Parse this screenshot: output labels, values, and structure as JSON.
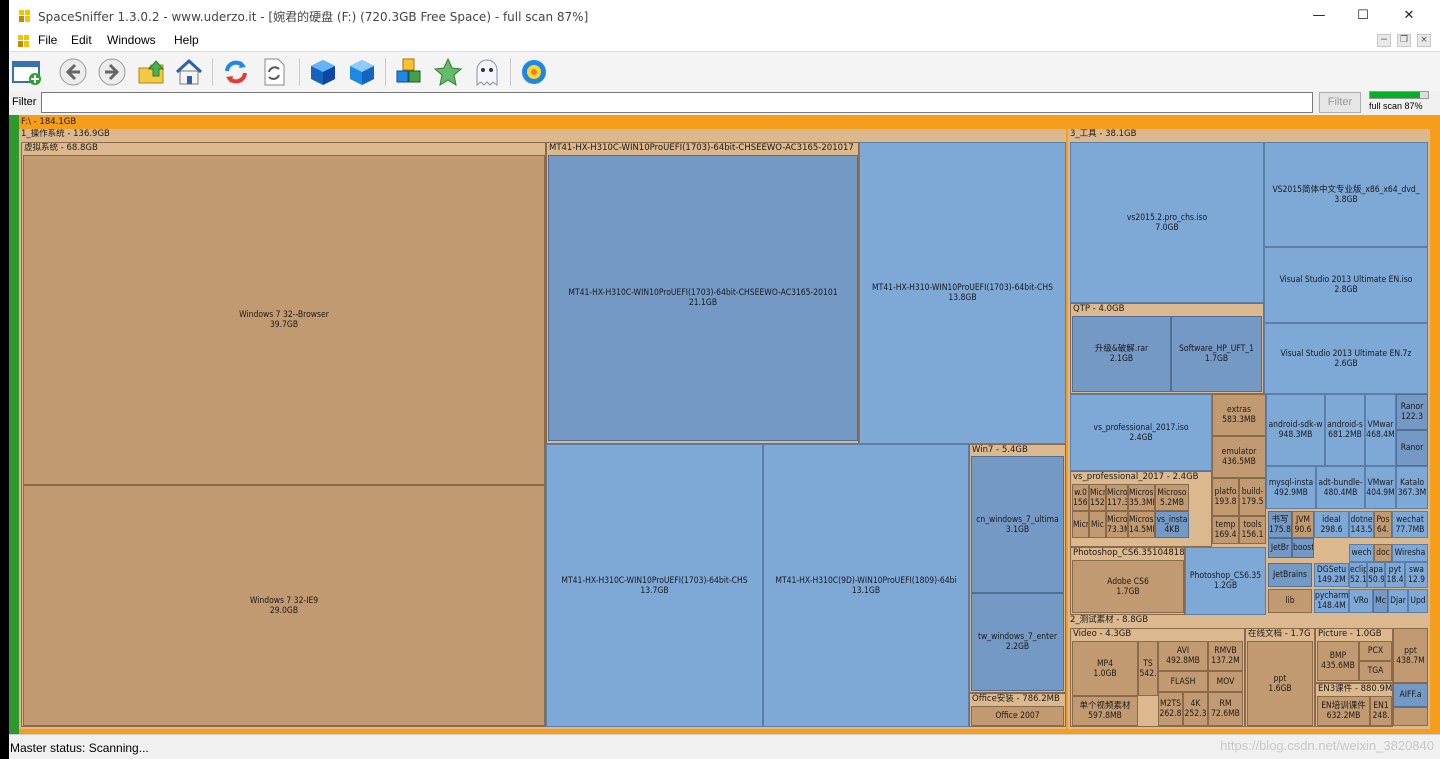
{
  "window": {
    "title": "SpaceSniffer 1.3.0.2 - www.uderzo.it - [婉君的硬盘 (F:) (720.3GB Free Space) - full scan 87%]",
    "controls": {
      "minimize": "—",
      "maximize": "☐",
      "close": "✕"
    }
  },
  "menu": [
    "File",
    "Edit",
    "Windows",
    "Help"
  ],
  "toolbar": {
    "icons": [
      "new-view-icon",
      "back-icon",
      "forward-icon",
      "up-folder-icon",
      "home-icon",
      "refresh-icon",
      "rescan-icon",
      "blue-cube-icon",
      "blue-cube-2-icon",
      "colored-cubes-icon",
      "star-icon",
      "ghost-icon",
      "gear-flower-icon"
    ]
  },
  "filter": {
    "label": "Filter",
    "value": "",
    "button": "Filter",
    "progress_text": "full scan 87%",
    "progress": 0.87
  },
  "map": {
    "root": "F:\\ - 184.1GB",
    "left_group": "1_操作系统 - 136.9GB",
    "vm_group": "虚拟系统 - 68.8GB",
    "win7_browser": {
      "name": "Windows 7 32--Browser",
      "size": "39.7GB"
    },
    "win7_ie9": {
      "name": "Windows 7 32-IE9",
      "size": "29.0GB"
    },
    "mt_group": "MT41-HX-H310C-WIN10ProUEFI(1703)-64bit-CHSEEWO-AC3165-201017",
    "mt1": {
      "name": "MT41-HX-H310C-WIN10ProUEFI(1703)-64bit-CHSEEWO-AC3165-20101",
      "size": "21.1GB"
    },
    "mt2": {
      "name": "MT41-HX-H310-WIN10ProUEFI(1703)-64bit-CHS",
      "size": "13.8GB"
    },
    "mt3": {
      "name": "MT41-HX-H310C-WIN10ProUEFI(1703)-64bit-CHS",
      "size": "13.7GB"
    },
    "mt4": {
      "name": "MT41-HX-H310C(9D)-WIN10ProUEFI(1809)-64bi",
      "size": "13.1GB"
    },
    "win7_group": "Win7 - 5.4GB",
    "cn_win7": {
      "name": "cn_windows_7_ultima",
      "size": "3.1GB"
    },
    "tw_win7": {
      "name": "tw_windows_7_enter",
      "size": "2.2GB"
    },
    "office_group": "Office安装 - 786.2MB",
    "office2007": "Office 2007",
    "tools_group": "3_工具 - 38.1GB",
    "vs2015": {
      "name": "vs2015.2.pro_chs.iso",
      "size": "7.0GB"
    },
    "vs2015b": {
      "name": "VS2015简体中文专业版_x86_x64_dvd_",
      "size": "3.8GB"
    },
    "vs2013a": {
      "name": "Visual Studio 2013 Ultimate EN.iso",
      "size": "2.8GB"
    },
    "vs2013b": {
      "name": "Visual Studio 2013 Ultimate EN.7z",
      "size": "2.6GB"
    },
    "qtp_group": "QTP - 4.0GB",
    "qtp_rar": {
      "name": "升级&破解.rar",
      "size": "2.1GB"
    },
    "qtp_uft": {
      "name": "Software_HP_UFT_1",
      "size": "1.7GB"
    },
    "vspro": {
      "name": "vs_professional_2017.iso",
      "size": "2.4GB"
    },
    "vspro_group": "vs_professional_2017 - 2.4GB",
    "extras": {
      "name": "extras",
      "size": "583.3MB"
    },
    "emulator": {
      "name": "emulator",
      "size": "436.5MB"
    },
    "android_sdk": {
      "name": "android-sdk-w",
      "size": "948.3MB"
    },
    "android_s": {
      "name": "android-s",
      "size": "681.2MB"
    },
    "vmware1": {
      "name": "VMwar",
      "size": "468.4M"
    },
    "rano1": {
      "name": "Ranor",
      "size": "122.3"
    },
    "rano2": {
      "name": "Ranor",
      "size": ""
    },
    "mysql": {
      "name": "mysql-insta",
      "size": "492.9MB"
    },
    "adt": {
      "name": "adt-bundle-",
      "size": "480.4MB"
    },
    "vmware2": {
      "name": "VMwar",
      "size": "404.9M"
    },
    "katalo": {
      "name": "Katalo",
      "size": "367.3M"
    },
    "photoshop_group": "Photoshop_CS6.351048188",
    "adobe_cs6": {
      "name": "Adobe CS6",
      "size": "1.7GB"
    },
    "photoshop_cs6": {
      "name": "Photoshop_CS6.35",
      "size": "1.2GB"
    },
    "test_group": "2_测试素材 - 8.8GB",
    "video_group": "Video - 4.3GB",
    "mp4": {
      "name": "MP4",
      "size": "1.0GB"
    },
    "ts": {
      "name": "TS",
      "size": "542."
    },
    "avi": {
      "name": "AVI",
      "size": "492.8MB"
    },
    "rmvb": {
      "name": "RMVB",
      "size": "137.2M"
    },
    "flash": "FLASH",
    "mov": "MOV",
    "single_video": {
      "name": "单个视频素材",
      "size": "597.8MB"
    },
    "m2ts": {
      "name": "M2TS",
      "size": "262.8"
    },
    "k4": {
      "name": "4K",
      "size": "252.3"
    },
    "rm": {
      "name": "RM",
      "size": "72.6MB"
    },
    "doc_group": "在线文档 - 1.7G",
    "ppt": {
      "name": "ppt",
      "size": "1.6GB"
    },
    "picture_group": "Picture - 1.0GB",
    "bmp": {
      "name": "BMP",
      "size": "435.6MB"
    },
    "pcx": "PCX",
    "tga": "TGA",
    "ppt2": {
      "name": "ppt",
      "size": "438.7M"
    },
    "en3_group": "EN3课件 - 880.9M",
    "en_train": {
      "name": "EN培训课件",
      "size": "632.2MB"
    },
    "en1": {
      "name": "EN1",
      "size": "248."
    },
    "aiff": "AIFF.a",
    "misc": [
      {
        "t": "w.0",
        "s": "156."
      },
      {
        "t": "Micr",
        "s": "152."
      },
      {
        "t": "Micros",
        "s": "117.3M"
      },
      {
        "t": "Microso",
        "s": "35.3MB"
      },
      {
        "t": "Microso",
        "s": "5.2MB"
      },
      {
        "t": "Micr",
        "s": ""
      },
      {
        "t": "Mic",
        "s": ""
      },
      {
        "t": "Micros",
        "s": "73.3M"
      },
      {
        "t": "Microso",
        "s": "14.5MB"
      },
      {
        "t": "vs_insta",
        "s": "4KB"
      },
      {
        "t": "platfo",
        "s": "193.8"
      },
      {
        "t": "build-",
        "s": "179.5"
      },
      {
        "t": "temp",
        "s": "169.4"
      },
      {
        "t": "tools",
        "s": "156.1"
      },
      {
        "t": "书写",
        "s": "175.8"
      },
      {
        "t": "JVM",
        "s": "90.6"
      },
      {
        "t": "ideaI",
        "s": "298.6"
      },
      {
        "t": "dotne",
        "s": "143.5"
      },
      {
        "t": "Pos",
        "s": "64."
      },
      {
        "t": "wechat",
        "s": "77.7MB"
      },
      {
        "t": "JetBr",
        "s": ""
      },
      {
        "t": "boost",
        "s": ""
      },
      {
        "t": "wech",
        "s": ""
      },
      {
        "t": "doc",
        "s": ""
      },
      {
        "t": "Wiresha",
        "s": ""
      },
      {
        "t": "JetBrains",
        "s": ""
      },
      {
        "t": "DGSetu",
        "s": "149.2M"
      },
      {
        "t": "eclip",
        "s": "52.1"
      },
      {
        "t": "apa",
        "s": "50.9"
      },
      {
        "t": "pyt",
        "s": "18.4"
      },
      {
        "t": "swa",
        "s": "12.9"
      },
      {
        "t": "lib",
        "s": ""
      },
      {
        "t": "pycharm",
        "s": "148.4M"
      },
      {
        "t": "VRo",
        "s": ""
      },
      {
        "t": "Mc",
        "s": ""
      },
      {
        "t": "Djar",
        "s": ""
      },
      {
        "t": "Upd",
        "s": ""
      }
    ]
  },
  "status": {
    "text": "Master status: Scanning...",
    "watermark": "https://blog.csdn.net/weixin_3820840"
  }
}
